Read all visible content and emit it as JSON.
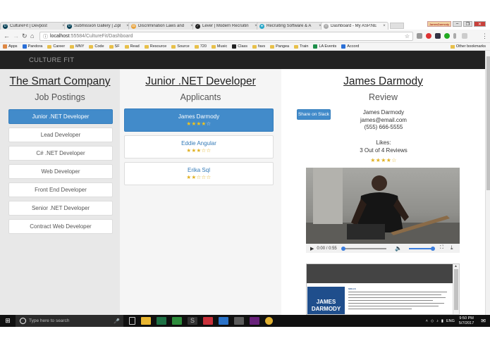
{
  "browser": {
    "tabs": [
      {
        "title": "CultureFit | Devpost",
        "icon_color": "#003e54",
        "icon_glyph": "D"
      },
      {
        "title": "Submission Gallery | Zipl",
        "icon_color": "#003e54",
        "icon_glyph": "D"
      },
      {
        "title": "Discrimination Laws and",
        "icon_color": "#e8a33d",
        "icon_glyph": "⚖"
      },
      {
        "title": "Lever | Modern Recruitin",
        "icon_color": "#222222",
        "icon_glyph": "∕"
      },
      {
        "title": "Recruiting Software & A",
        "icon_color": "#2aa8c9",
        "icon_glyph": "●"
      },
      {
        "title": "Dashboard - My ASP.NE",
        "icon_color": "#aaaaaa",
        "icon_glyph": "□"
      }
    ],
    "tab_close": "×",
    "profile_label": "JamesDarmody",
    "url_host": "localhost",
    "url_path": ":55584/CultureFit/Dashboard",
    "bookmarks": [
      {
        "label": "Apps",
        "kind": "apps"
      },
      {
        "label": "Pandora",
        "kind": "blue"
      },
      {
        "label": "Career",
        "kind": "folder"
      },
      {
        "label": "MNY",
        "kind": "folder"
      },
      {
        "label": "Code",
        "kind": "folder"
      },
      {
        "label": "SF",
        "kind": "folder"
      },
      {
        "label": "Read",
        "kind": "folder"
      },
      {
        "label": "Resource",
        "kind": "folder"
      },
      {
        "label": "Source",
        "kind": "folder"
      },
      {
        "label": "720",
        "kind": "folder"
      },
      {
        "label": "Music",
        "kind": "folder"
      },
      {
        "label": "Class",
        "kind": "dark"
      },
      {
        "label": "favs",
        "kind": "folder"
      },
      {
        "label": "Pangea",
        "kind": "folder"
      },
      {
        "label": "Train",
        "kind": "folder"
      },
      {
        "label": "LA Events",
        "kind": "green"
      },
      {
        "label": "Accord",
        "kind": "blue"
      }
    ],
    "other_bookmarks": "Other bookmarks"
  },
  "app": {
    "brand": "CULTURE FIT"
  },
  "company": {
    "name": "The Smart Company",
    "subtitle": "Job Postings",
    "postings": [
      "Junior .NET Developer",
      "Lead Developer",
      "C# .NET Developer",
      "Web Developer",
      "Front End Developer",
      "Senior .NET Developer",
      "Contract Web Developer"
    ],
    "active_index": 0
  },
  "job": {
    "title": "Junior .NET Developer",
    "subtitle": "Applicants",
    "applicants": [
      {
        "name": "James Darmody",
        "rating": 4
      },
      {
        "name": "Eddie Angular",
        "rating": 3
      },
      {
        "name": "Erika Sql",
        "rating": 2
      }
    ],
    "active_index": 0,
    "max_rating": 5
  },
  "candidate": {
    "name": "James Darmody",
    "subtitle": "Review",
    "share_label": "Share on Slack",
    "display_name": "James Darmody",
    "email": "james@email.com",
    "phone": "(555) 666-5555",
    "likes_label": "Likes:",
    "likes_summary": "3 Out of 4 Reviews",
    "rating": 4,
    "video_time": "0:00 / 0:55",
    "video_progress": 0.0,
    "volume": 1.0,
    "resume_name_1": "JAMES",
    "resume_name_2": "DARMODY",
    "resume_heading": "SKILLS"
  },
  "taskbar": {
    "search_placeholder": "Type here to search",
    "lang": "ENG",
    "time": "9:50 PM",
    "date": "5/7/2017"
  }
}
